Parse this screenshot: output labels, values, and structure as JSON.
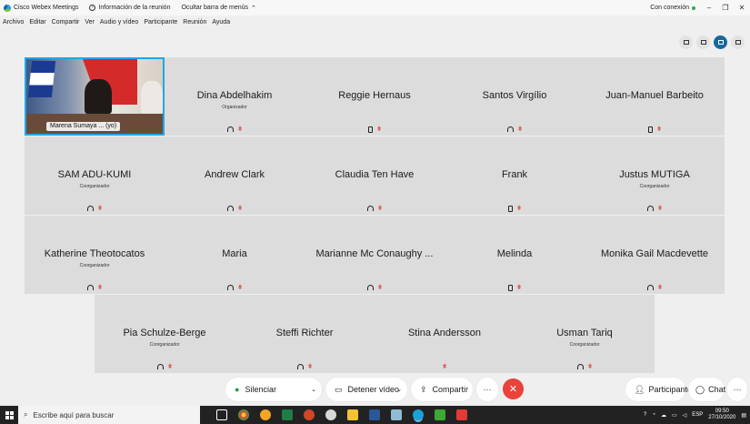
{
  "window": {
    "app_title": "Cisco Webex Meetings",
    "meeting_info": "Información de la reunión",
    "hide_menu": "Ocultar barra de menús",
    "connection": "Con conexión",
    "connection_color": "#2fa84f"
  },
  "menu": [
    "Archivo",
    "Editar",
    "Compartir",
    "Ver",
    "Audio y vídeo",
    "Participante",
    "Reunión",
    "Ayuda"
  ],
  "participants": [
    {
      "name": "Marena Sumaya ... (yo)",
      "role": "",
      "icons": [
        "headset-icon",
        "muted-mic-icon"
      ],
      "video": true
    },
    {
      "name": "Dina Abdelhakim",
      "role": "Organizador",
      "icons": [
        "headset-icon",
        "muted-mic-icon"
      ]
    },
    {
      "name": "Reggie Hernaus",
      "role": "",
      "icons": [
        "phone-icon",
        "muted-mic-icon"
      ]
    },
    {
      "name": "Santos Virgílio",
      "role": "",
      "icons": [
        "headset-icon",
        "muted-mic-icon"
      ]
    },
    {
      "name": "Juan-Manuel Barbeito",
      "role": "",
      "icons": [
        "phone-icon",
        "muted-mic-icon"
      ]
    },
    {
      "name": "SAM ADU-KUMI",
      "role": "Coorganizador",
      "icons": [
        "headset-icon",
        "muted-mic-icon"
      ]
    },
    {
      "name": "Andrew Clark",
      "role": "",
      "icons": [
        "headset-icon",
        "muted-mic-icon"
      ]
    },
    {
      "name": "Claudia Ten Have",
      "role": "",
      "icons": [
        "headset-icon",
        "muted-mic-icon"
      ]
    },
    {
      "name": "Frank",
      "role": "",
      "icons": [
        "phone-icon",
        "muted-mic-icon"
      ]
    },
    {
      "name": "Justus MUTIGA",
      "role": "Coorganizador",
      "icons": [
        "headset-icon",
        "muted-mic-icon"
      ]
    },
    {
      "name": "Katherine Theotocatos",
      "role": "Coorganizador",
      "icons": [
        "headset-icon",
        "muted-mic-icon"
      ]
    },
    {
      "name": "Maria",
      "role": "",
      "icons": [
        "headset-icon",
        "muted-mic-icon"
      ]
    },
    {
      "name": "Marianne Mc Conaughy ...",
      "role": "",
      "icons": [
        "headset-icon",
        "muted-mic-icon"
      ]
    },
    {
      "name": "Melinda",
      "role": "",
      "icons": [
        "phone-icon",
        "muted-mic-icon"
      ]
    },
    {
      "name": "Monika Gail Macdevette",
      "role": "",
      "icons": [
        "headset-icon",
        "muted-mic-icon"
      ]
    },
    {
      "name": "Pia Schulze-Berge",
      "role": "Coorganizador",
      "icons": [
        "headset-icon",
        "muted-mic-icon"
      ]
    },
    {
      "name": "Steffi Richter",
      "role": "",
      "icons": [
        "headset-icon",
        "muted-mic-icon"
      ]
    },
    {
      "name": "Stina Andersson",
      "role": "",
      "icons": [
        "muted-mic-icon"
      ]
    },
    {
      "name": "Usman Tariq",
      "role": "Coorganizador",
      "icons": [
        "headset-icon",
        "muted-mic-icon"
      ]
    }
  ],
  "controls": {
    "mute_label": "Silenciar",
    "video_label": "Detener vídeo",
    "share_label": "Compartir",
    "participants_label": "Participantes",
    "chat_label": "Chat",
    "more": "···",
    "end": "✕"
  },
  "taskbar": {
    "search_placeholder": "Escribe aquí para buscar",
    "language": "ESP",
    "time": "09:50",
    "date": "27/10/2020"
  }
}
